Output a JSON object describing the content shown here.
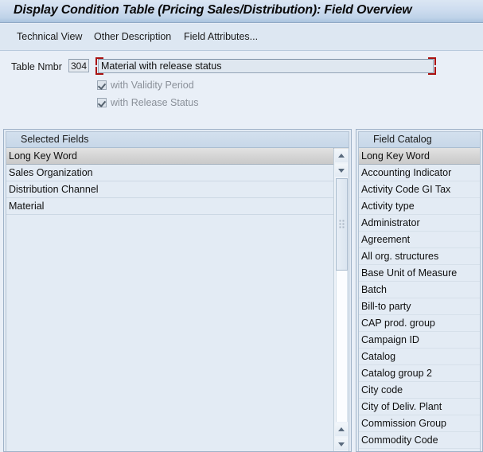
{
  "window": {
    "title": "Display Condition Table (Pricing Sales/Distribution): Field Overview"
  },
  "toolbar": {
    "items": [
      {
        "label": "Technical View",
        "name": "technical-view"
      },
      {
        "label": "Other Description",
        "name": "other-description"
      },
      {
        "label": "Field Attributes...",
        "name": "field-attributes"
      }
    ]
  },
  "form": {
    "table_nmbr_label": "Table Nmbr",
    "table_nmbr_value": "304",
    "description_value": "Material with release status",
    "description_placeholder": "",
    "checkboxes": [
      {
        "label": "with Validity Period",
        "checked": true,
        "enabled": false,
        "name": "with-validity-period"
      },
      {
        "label": "with Release Status",
        "checked": true,
        "enabled": false,
        "name": "with-release-status"
      }
    ]
  },
  "selected_fields": {
    "panel_title": "Selected Fields",
    "column_header": "Long Key Word",
    "rows": [
      "Sales Organization",
      "Distribution Channel",
      "Material"
    ]
  },
  "field_catalog": {
    "panel_title": "Field Catalog",
    "column_header": "Long Key Word",
    "rows": [
      "Accounting Indicator",
      "Activity Code GI Tax",
      "Activity type",
      "Administrator",
      "Agreement",
      "All org. structures",
      "Base Unit of Measure",
      "Batch",
      "Bill-to party",
      "CAP prod. group",
      "Campaign ID",
      "Catalog",
      "Catalog group 2",
      "City code",
      "City of Deliv. Plant",
      "Commission Group",
      "Commodity Code"
    ]
  },
  "icons": {
    "column_config": "column-config-icon",
    "scroll_up": "arrow-up-icon",
    "scroll_down": "arrow-down-icon"
  },
  "colors": {
    "background": "#e9eff7",
    "title_bar": "#cddcef",
    "panel_bg": "#e3ebf4",
    "required_marker": "#aa1111",
    "header_grey": "#d5d5d5"
  }
}
